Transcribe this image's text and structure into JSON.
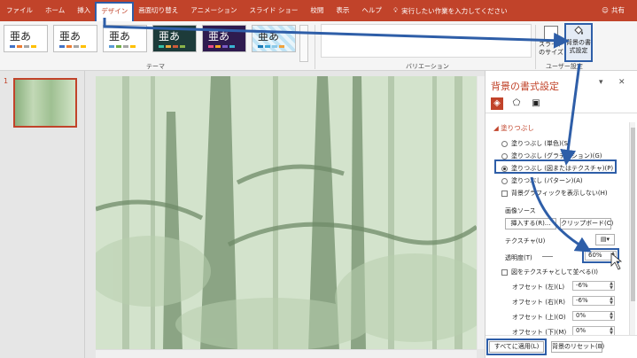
{
  "ribbon": {
    "tabs": [
      {
        "label": "ファイル"
      },
      {
        "label": "ホーム"
      },
      {
        "label": "挿入"
      },
      {
        "label": "デザイン"
      },
      {
        "label": "画面切り替え"
      },
      {
        "label": "アニメーション"
      },
      {
        "label": "スライド ショー"
      },
      {
        "label": "校閲"
      },
      {
        "label": "表示"
      },
      {
        "label": "ヘルプ"
      }
    ],
    "tell_me": "実行したい作業を入力してください",
    "share": "共有",
    "theme_sample": "亜あ",
    "groups": {
      "themes": "テーマ",
      "variations": "バリエーション",
      "customize": "ユーザー設定"
    },
    "slide_size": "スライドのサイズ",
    "format_background": "背景の書式設定"
  },
  "thumbnails": {
    "number": "1"
  },
  "pane": {
    "title": "背景の書式設定",
    "section_fill": "塗りつぶし",
    "options": [
      {
        "label": "塗りつぶし (単色)(S)"
      },
      {
        "label": "塗りつぶし (グラデーション)(G)"
      },
      {
        "label": "塗りつぶし (図またはテクスチャ)(P)"
      },
      {
        "label": "塗りつぶし (パターン)(A)"
      }
    ],
    "hide_graphics": "背景グラフィックを表示しない(H)",
    "image_source": "画像ソース",
    "insert_button": "挿入する(R)...",
    "clipboard_button": "クリップボード(C)",
    "texture_label": "テクスチャ(U)",
    "transparency_label": "透明度(T)",
    "transparency_value": "60%",
    "tile_label": "図をテクスチャとして並べる(I)",
    "offsets": [
      {
        "label": "オフセット (左)(L)",
        "value": "-6%"
      },
      {
        "label": "オフセット (右)(R)",
        "value": "-6%"
      },
      {
        "label": "オフセット (上)(O)",
        "value": "0%"
      },
      {
        "label": "オフセット (下)(M)",
        "value": "0%"
      }
    ],
    "apply_all": "すべてに適用(L)",
    "reset": "背景のリセット(B)"
  },
  "colors": {
    "accent": "#c1432a",
    "highlight": "#2e5ea8"
  }
}
